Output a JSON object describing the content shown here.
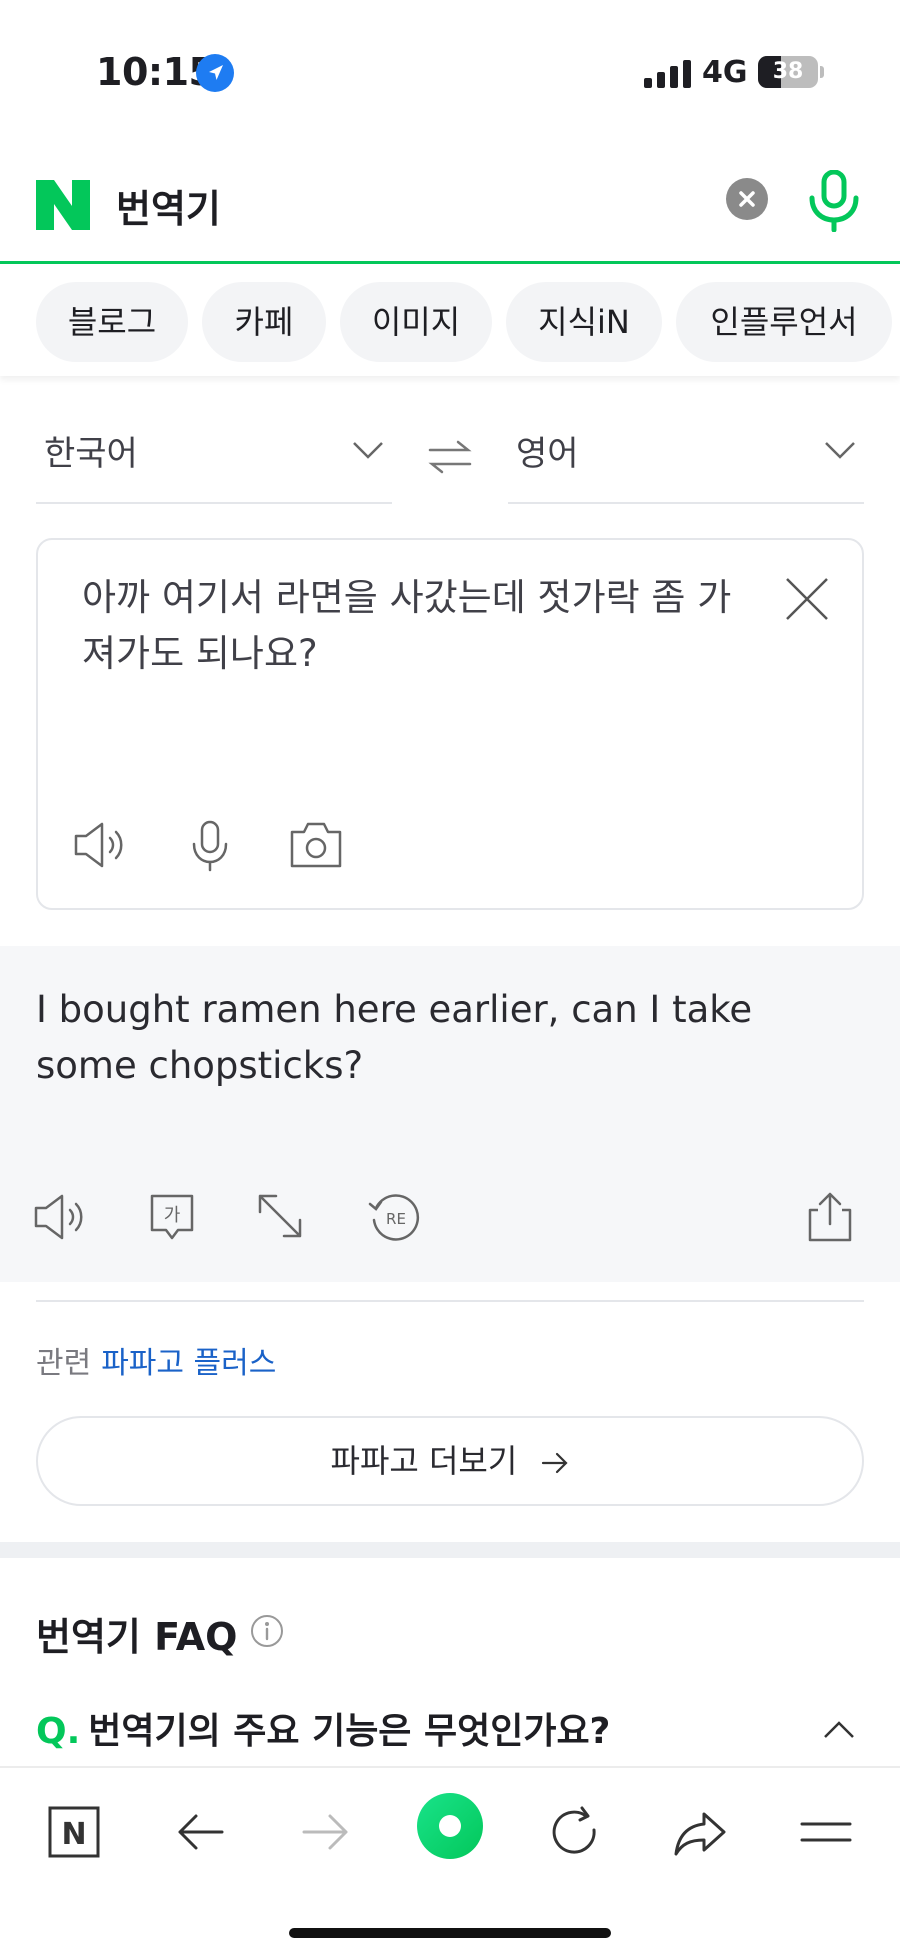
{
  "status_bar": {
    "time": "10:15",
    "network": "4G",
    "battery": "38",
    "battery_level": 0.38
  },
  "search": {
    "query": "번역기",
    "logo": "N",
    "clear_icon": "clear-circle-icon",
    "mic_icon": "microphone-icon"
  },
  "chips": [
    {
      "label": "블로그"
    },
    {
      "label": "카페"
    },
    {
      "label": "이미지"
    },
    {
      "label": "지식iN"
    },
    {
      "label": "인플루언서"
    }
  ],
  "translator": {
    "source_lang": "한국어",
    "target_lang": "영어",
    "input_text": "아까 여기서 라면을 사갔는데 젓가락 좀 가져가도 되나요?",
    "output_text": "I bought ramen here earlier, can I take some chopsticks?",
    "icon_re": "RE",
    "icon_ga": "가"
  },
  "related": {
    "label": "관련",
    "link": "파파고 플러스"
  },
  "more_button": {
    "label": "파파고 더보기"
  },
  "faq": {
    "title": "번역기 FAQ",
    "q_mark": "Q.",
    "question": "번역기의 주요 기능은 무엇인가요?"
  },
  "toolbar": {
    "home_label": "N"
  },
  "colors": {
    "brand_green": "#03c75a",
    "link_blue": "#1a62c8",
    "location_blue": "#1e7cf2"
  }
}
